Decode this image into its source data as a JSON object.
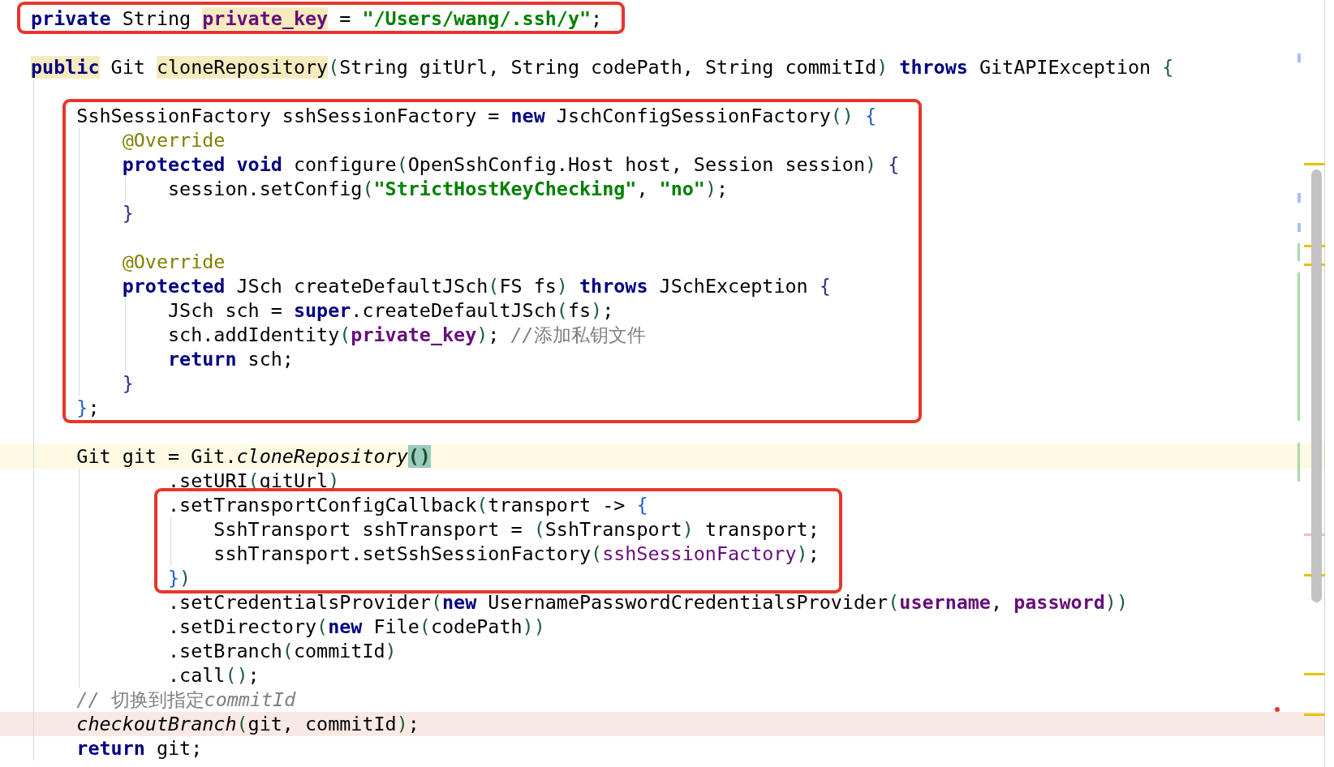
{
  "editor": {
    "code": [
      {
        "kind": "line",
        "annotated": true,
        "tokens": [
          {
            "text": "private",
            "kind": "keyword"
          },
          {
            "text": " String ",
            "kind": "plain"
          },
          {
            "text": "private_key",
            "kind": "field",
            "highlighted": true
          },
          {
            "text": " = ",
            "kind": "plain"
          },
          {
            "text": "\"/Users/wang/.ssh/y\"",
            "kind": "string"
          },
          {
            "text": ";",
            "kind": "plain"
          }
        ]
      },
      {
        "kind": "blank"
      },
      {
        "kind": "line",
        "tokens": [
          {
            "text": "public",
            "kind": "keyword",
            "highlighted": true
          },
          {
            "text": " Git ",
            "kind": "plain"
          },
          {
            "text": "cloneRepository",
            "kind": "plain",
            "highlighted": true
          },
          {
            "text": "(",
            "kind": "bracket",
            "color": "#1f5c3a"
          },
          {
            "text": "String gitUrl, String codePath, String commitId",
            "kind": "plain"
          },
          {
            "text": ")",
            "kind": "bracket",
            "color": "#1f5c3a"
          },
          {
            "text": " throws",
            "kind": "keyword"
          },
          {
            "text": " GitAPIException ",
            "kind": "plain"
          },
          {
            "text": "{",
            "kind": "bracket",
            "color": "#1f5c3a"
          }
        ],
        "children": [
          {
            "kind": "blank"
          },
          {
            "kind": "line",
            "annotated": true,
            "tokens": [
              {
                "text": "SshSessionFactory sshSessionFactory = ",
                "kind": "plain"
              },
              {
                "text": "new",
                "kind": "keyword"
              },
              {
                "text": " JschConfigSessionFactory",
                "kind": "plain"
              },
              {
                "text": "()",
                "kind": "bracket",
                "color": "#1f5c3a"
              },
              {
                "text": " {",
                "kind": "bracket",
                "color": "#2461cf"
              }
            ],
            "children": [
              {
                "kind": "line",
                "tokens": [
                  {
                    "text": "@Override",
                    "kind": "annotation"
                  }
                ]
              },
              {
                "kind": "line",
                "tokens": [
                  {
                    "text": "protected void",
                    "kind": "keyword"
                  },
                  {
                    "text": " configure",
                    "kind": "plain"
                  },
                  {
                    "text": "(",
                    "kind": "bracket",
                    "color": "#1f5c3a"
                  },
                  {
                    "text": "OpenSshConfig.Host host, Session session",
                    "kind": "plain"
                  },
                  {
                    "text": ")",
                    "kind": "bracket",
                    "color": "#1f5c3a"
                  },
                  {
                    "text": " {",
                    "kind": "bracket",
                    "color": "#2e2f86"
                  }
                ],
                "children": [
                  {
                    "kind": "line",
                    "tokens": [
                      {
                        "text": "session.setConfig",
                        "kind": "plain"
                      },
                      {
                        "text": "(",
                        "kind": "bracket",
                        "color": "#1f5c3a"
                      },
                      {
                        "text": "\"StrictHostKeyChecking\"",
                        "kind": "string"
                      },
                      {
                        "text": ", ",
                        "kind": "plain"
                      },
                      {
                        "text": "\"no\"",
                        "kind": "string"
                      },
                      {
                        "text": ")",
                        "kind": "bracket",
                        "color": "#1f5c3a"
                      },
                      {
                        "text": ";",
                        "kind": "plain"
                      }
                    ]
                  }
                ],
                "closing": [
                  {
                    "text": "}",
                    "kind": "bracket",
                    "color": "#2e2f86"
                  }
                ]
              },
              {
                "kind": "blank"
              },
              {
                "kind": "line",
                "tokens": [
                  {
                    "text": "@Override",
                    "kind": "annotation"
                  }
                ]
              },
              {
                "kind": "line",
                "tokens": [
                  {
                    "text": "protected",
                    "kind": "keyword"
                  },
                  {
                    "text": " JSch createDefaultJSch",
                    "kind": "plain"
                  },
                  {
                    "text": "(",
                    "kind": "bracket",
                    "color": "#1f5c3a"
                  },
                  {
                    "text": "FS fs",
                    "kind": "plain"
                  },
                  {
                    "text": ")",
                    "kind": "bracket",
                    "color": "#1f5c3a"
                  },
                  {
                    "text": " throws",
                    "kind": "keyword"
                  },
                  {
                    "text": " JSchException ",
                    "kind": "plain"
                  },
                  {
                    "text": "{",
                    "kind": "bracket",
                    "color": "#2e2f86"
                  }
                ],
                "children": [
                  {
                    "kind": "line",
                    "tokens": [
                      {
                        "text": "JSch sch = ",
                        "kind": "plain"
                      },
                      {
                        "text": "super",
                        "kind": "keyword"
                      },
                      {
                        "text": ".createDefaultJSch",
                        "kind": "plain"
                      },
                      {
                        "text": "(",
                        "kind": "bracket",
                        "color": "#1f5c3a"
                      },
                      {
                        "text": "fs",
                        "kind": "plain"
                      },
                      {
                        "text": ")",
                        "kind": "bracket",
                        "color": "#1f5c3a"
                      },
                      {
                        "text": ";",
                        "kind": "plain"
                      }
                    ]
                  },
                  {
                    "kind": "line",
                    "tokens": [
                      {
                        "text": "sch.addIdentity",
                        "kind": "plain"
                      },
                      {
                        "text": "(",
                        "kind": "bracket",
                        "color": "#1f5c3a"
                      },
                      {
                        "text": "private_key",
                        "kind": "field"
                      },
                      {
                        "text": ")",
                        "kind": "bracket",
                        "color": "#1f5c3a"
                      },
                      {
                        "text": "; ",
                        "kind": "plain"
                      },
                      {
                        "text": "//添加私钥文件",
                        "kind": "comment"
                      }
                    ]
                  },
                  {
                    "kind": "line",
                    "tokens": [
                      {
                        "text": "return",
                        "kind": "keyword"
                      },
                      {
                        "text": " sch;",
                        "kind": "plain"
                      }
                    ]
                  }
                ],
                "closing": [
                  {
                    "text": "}",
                    "kind": "bracket",
                    "color": "#2e2f86"
                  }
                ]
              }
            ],
            "closing": [
              {
                "text": "}",
                "kind": "bracket",
                "color": "#2461cf"
              },
              {
                "text": ";",
                "kind": "plain"
              }
            ]
          },
          {
            "kind": "blank"
          },
          {
            "kind": "line",
            "current": true,
            "tokens": [
              {
                "text": "Git git = Git.",
                "kind": "plain"
              },
              {
                "text": "cloneRepository",
                "kind": "static"
              },
              {
                "text": "()",
                "kind": "bracket",
                "matched": true
              }
            ],
            "children": [
              {
                "kind": "group",
                "children": [
                  {
                    "kind": "line",
                    "tokens": [
                      {
                        "text": ".setURI",
                        "kind": "plain"
                      },
                      {
                        "text": "(",
                        "kind": "bracket",
                        "color": "#1f5c3a"
                      },
                      {
                        "text": "gitUrl",
                        "kind": "plain"
                      },
                      {
                        "text": ")",
                        "kind": "bracket",
                        "color": "#1f5c3a"
                      }
                    ]
                  },
                  {
                    "kind": "line",
                    "annotated": true,
                    "tokens": [
                      {
                        "text": ".setTransportConfigCallback",
                        "kind": "plain"
                      },
                      {
                        "text": "(",
                        "kind": "bracket",
                        "color": "#1f5c3a"
                      },
                      {
                        "text": "transport -> ",
                        "kind": "plain"
                      },
                      {
                        "text": "{",
                        "kind": "bracket",
                        "color": "#2461cf"
                      }
                    ],
                    "children": [
                      {
                        "kind": "line",
                        "tokens": [
                          {
                            "text": "SshTransport sshTransport = ",
                            "kind": "plain"
                          },
                          {
                            "text": "(",
                            "kind": "bracket",
                            "color": "#1f5c3a"
                          },
                          {
                            "text": "SshTransport",
                            "kind": "plain"
                          },
                          {
                            "text": ")",
                            "kind": "bracket",
                            "color": "#1f5c3a"
                          },
                          {
                            "text": " transport;",
                            "kind": "plain"
                          }
                        ]
                      },
                      {
                        "kind": "line",
                        "tokens": [
                          {
                            "text": "sshTransport.setSshSessionFactory",
                            "kind": "plain"
                          },
                          {
                            "text": "(",
                            "kind": "bracket",
                            "color": "#1f5c3a"
                          },
                          {
                            "text": "sshSessionFactory",
                            "kind": "capture"
                          },
                          {
                            "text": ")",
                            "kind": "bracket",
                            "color": "#1f5c3a"
                          },
                          {
                            "text": ";",
                            "kind": "plain"
                          }
                        ]
                      }
                    ],
                    "closing": [
                      {
                        "text": "}",
                        "kind": "bracket",
                        "color": "#2461cf"
                      },
                      {
                        "text": ")",
                        "kind": "bracket",
                        "color": "#1f5c3a"
                      }
                    ]
                  },
                  {
                    "kind": "line",
                    "tokens": [
                      {
                        "text": ".setCredentialsProvider",
                        "kind": "plain"
                      },
                      {
                        "text": "(",
                        "kind": "bracket",
                        "color": "#1f5c3a"
                      },
                      {
                        "text": "new",
                        "kind": "keyword"
                      },
                      {
                        "text": " UsernamePasswordCredentialsProvider",
                        "kind": "plain"
                      },
                      {
                        "text": "(",
                        "kind": "bracket",
                        "color": "#1f5c3a"
                      },
                      {
                        "text": "username",
                        "kind": "field"
                      },
                      {
                        "text": ", ",
                        "kind": "plain"
                      },
                      {
                        "text": "password",
                        "kind": "field"
                      },
                      {
                        "text": "))",
                        "kind": "bracket",
                        "color": "#1f5c3a"
                      }
                    ]
                  },
                  {
                    "kind": "line",
                    "tokens": [
                      {
                        "text": ".setDirectory",
                        "kind": "plain"
                      },
                      {
                        "text": "(",
                        "kind": "bracket",
                        "color": "#1f5c3a"
                      },
                      {
                        "text": "new",
                        "kind": "keyword"
                      },
                      {
                        "text": " File",
                        "kind": "plain"
                      },
                      {
                        "text": "(",
                        "kind": "bracket",
                        "color": "#1f5c3a"
                      },
                      {
                        "text": "codePath",
                        "kind": "plain"
                      },
                      {
                        "text": "))",
                        "kind": "bracket",
                        "color": "#1f5c3a"
                      }
                    ]
                  },
                  {
                    "kind": "line",
                    "tokens": [
                      {
                        "text": ".setBranch",
                        "kind": "plain"
                      },
                      {
                        "text": "(",
                        "kind": "bracket",
                        "color": "#1f5c3a"
                      },
                      {
                        "text": "commitId",
                        "kind": "plain"
                      },
                      {
                        "text": ")",
                        "kind": "bracket",
                        "color": "#1f5c3a"
                      }
                    ]
                  },
                  {
                    "kind": "line",
                    "tokens": [
                      {
                        "text": ".call",
                        "kind": "plain"
                      },
                      {
                        "text": "()",
                        "kind": "bracket",
                        "color": "#1f5c3a"
                      },
                      {
                        "text": ";",
                        "kind": "plain"
                      }
                    ]
                  }
                ]
              }
            ]
          },
          {
            "kind": "line",
            "tokens": [
              {
                "text": "// 切换到指定commitId",
                "kind": "comment"
              }
            ]
          },
          {
            "kind": "line",
            "marked": true,
            "tokens": [
              {
                "text": "checkoutBranch",
                "kind": "static"
              },
              {
                "text": "(",
                "kind": "bracket",
                "color": "#1f5c3a"
              },
              {
                "text": "git, commitId",
                "kind": "plain"
              },
              {
                "text": ")",
                "kind": "bracket",
                "color": "#1f5c3a"
              },
              {
                "text": ";",
                "kind": "plain"
              }
            ]
          },
          {
            "kind": "line",
            "tokens": [
              {
                "text": "return",
                "kind": "keyword"
              },
              {
                "text": " git;",
                "kind": "plain"
              }
            ]
          }
        ]
      }
    ]
  }
}
